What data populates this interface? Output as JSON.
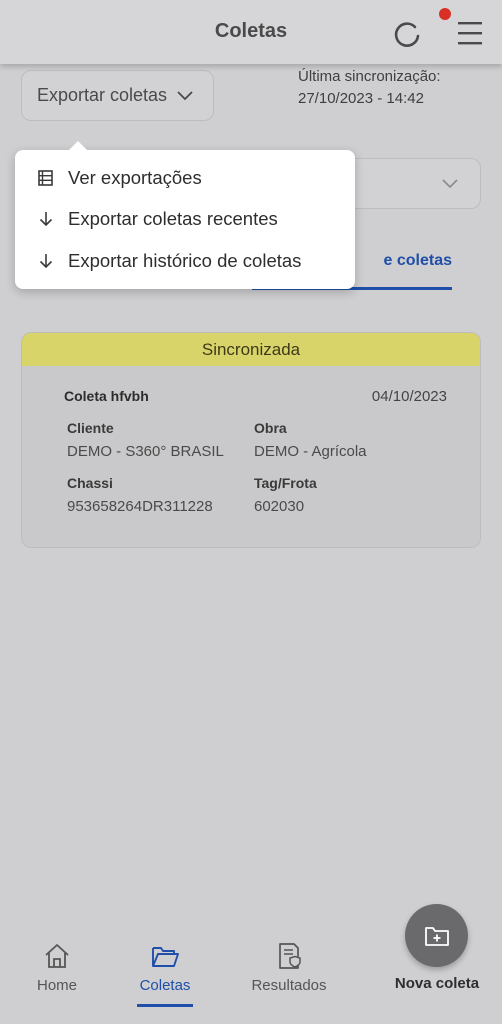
{
  "header": {
    "title": "Coletas"
  },
  "toolbar": {
    "export_label": "Exportar coletas",
    "sync_label": "Última sincronização:",
    "sync_value": "27/10/2023 - 14:42"
  },
  "tabs": {
    "active_partial": "e coletas"
  },
  "dropdown": {
    "items": [
      {
        "label": "Ver exportações",
        "icon": "list-icon"
      },
      {
        "label": "Exportar coletas recentes",
        "icon": "arrow-down-icon"
      },
      {
        "label": "Exportar histórico de coletas",
        "icon": "arrow-down-icon"
      }
    ]
  },
  "card": {
    "status": "Sincronizada",
    "title": "Coleta hfvbh",
    "date": "04/10/2023",
    "fields": {
      "cliente_label": "Cliente",
      "cliente_value": "DEMO - S360° BRASIL",
      "obra_label": "Obra",
      "obra_value": "DEMO - Agrícola",
      "chassi_label": "Chassi",
      "chassi_value": "953658264DR311228",
      "tag_label": "Tag/Frota",
      "tag_value": "602030"
    }
  },
  "nav": {
    "home": "Home",
    "coletas": "Coletas",
    "resultados": "Resultados",
    "nova_coleta": "Nova coleta"
  },
  "colors": {
    "accent": "#1f4fa8",
    "status_synced": "#d8d46a",
    "notification_dot": "#d93025"
  }
}
